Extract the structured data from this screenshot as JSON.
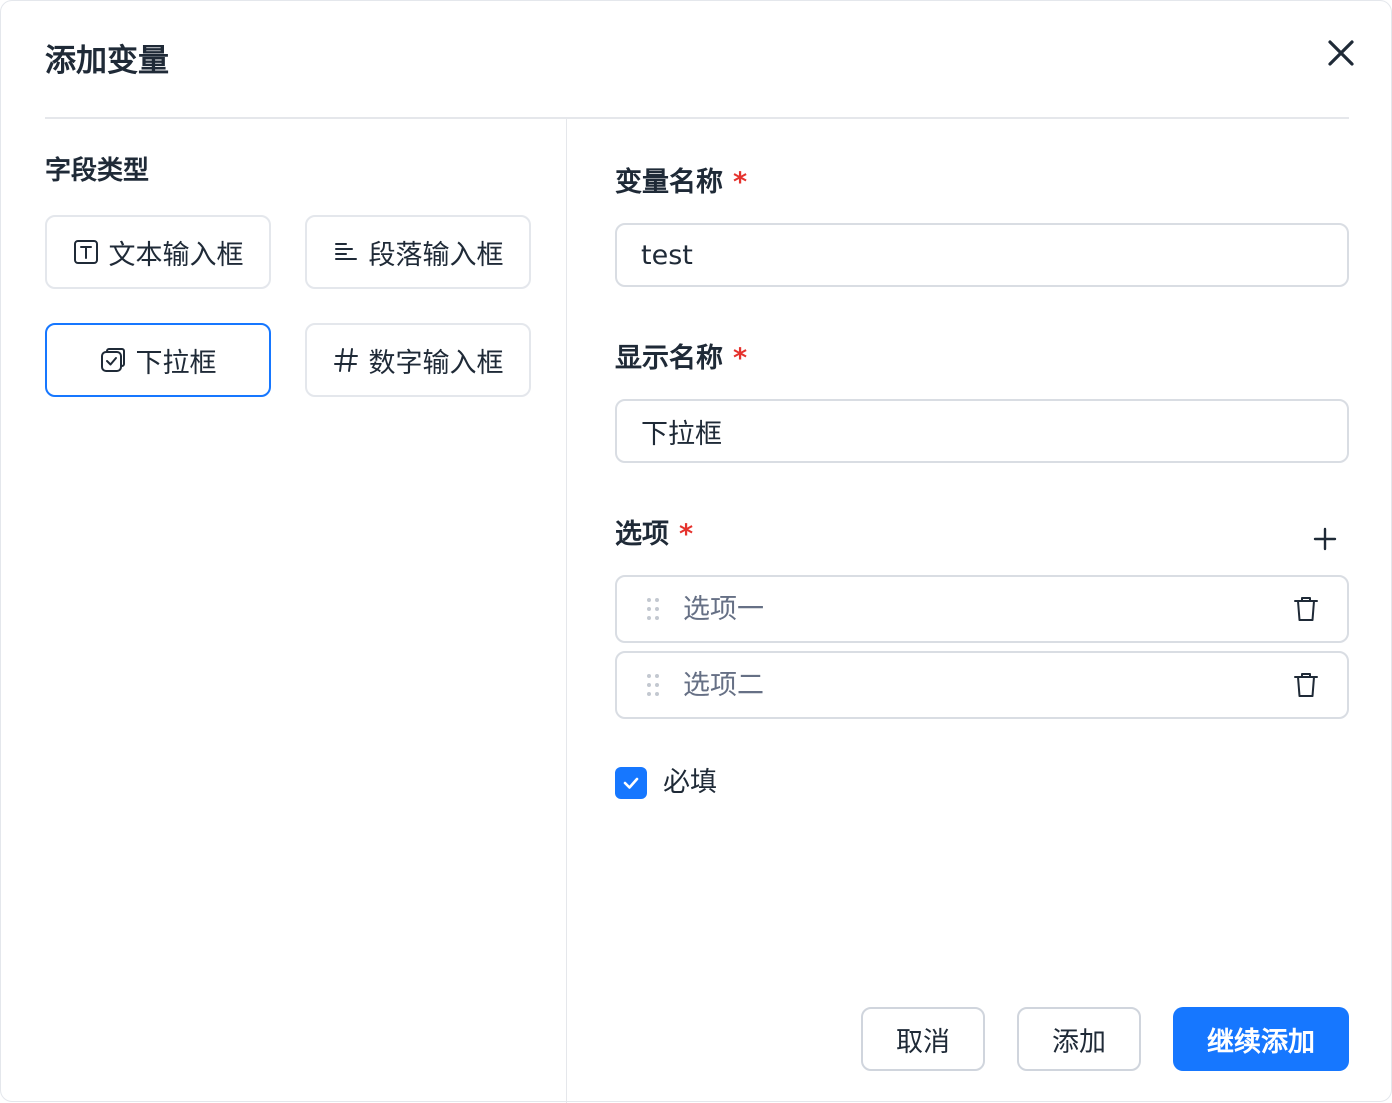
{
  "dialog": {
    "title": "添加变量"
  },
  "field_types": {
    "label": "字段类型",
    "items": [
      {
        "label": "文本输入框",
        "icon": "text-box-icon",
        "selected": false
      },
      {
        "label": "段落输入框",
        "icon": "paragraph-lines-icon",
        "selected": false
      },
      {
        "label": "下拉框",
        "icon": "dropdown-box-icon",
        "selected": true
      },
      {
        "label": "数字输入框",
        "icon": "hash-icon",
        "selected": false
      }
    ]
  },
  "form": {
    "variable_name": {
      "label": "变量名称",
      "required_mark": "*",
      "value": "test"
    },
    "display_name": {
      "label": "显示名称",
      "required_mark": "*",
      "value": "下拉框"
    },
    "options": {
      "label": "选项",
      "required_mark": "*",
      "items": [
        {
          "placeholder": "选项一"
        },
        {
          "placeholder": "选项二"
        }
      ]
    },
    "required_checkbox": {
      "label": "必填",
      "checked": true
    }
  },
  "footer": {
    "cancel_label": "取消",
    "add_label": "添加",
    "continue_add_label": "继续添加"
  },
  "colors": {
    "accent": "#1677ff",
    "required": "#e5322d",
    "border": "#d9dde3"
  }
}
